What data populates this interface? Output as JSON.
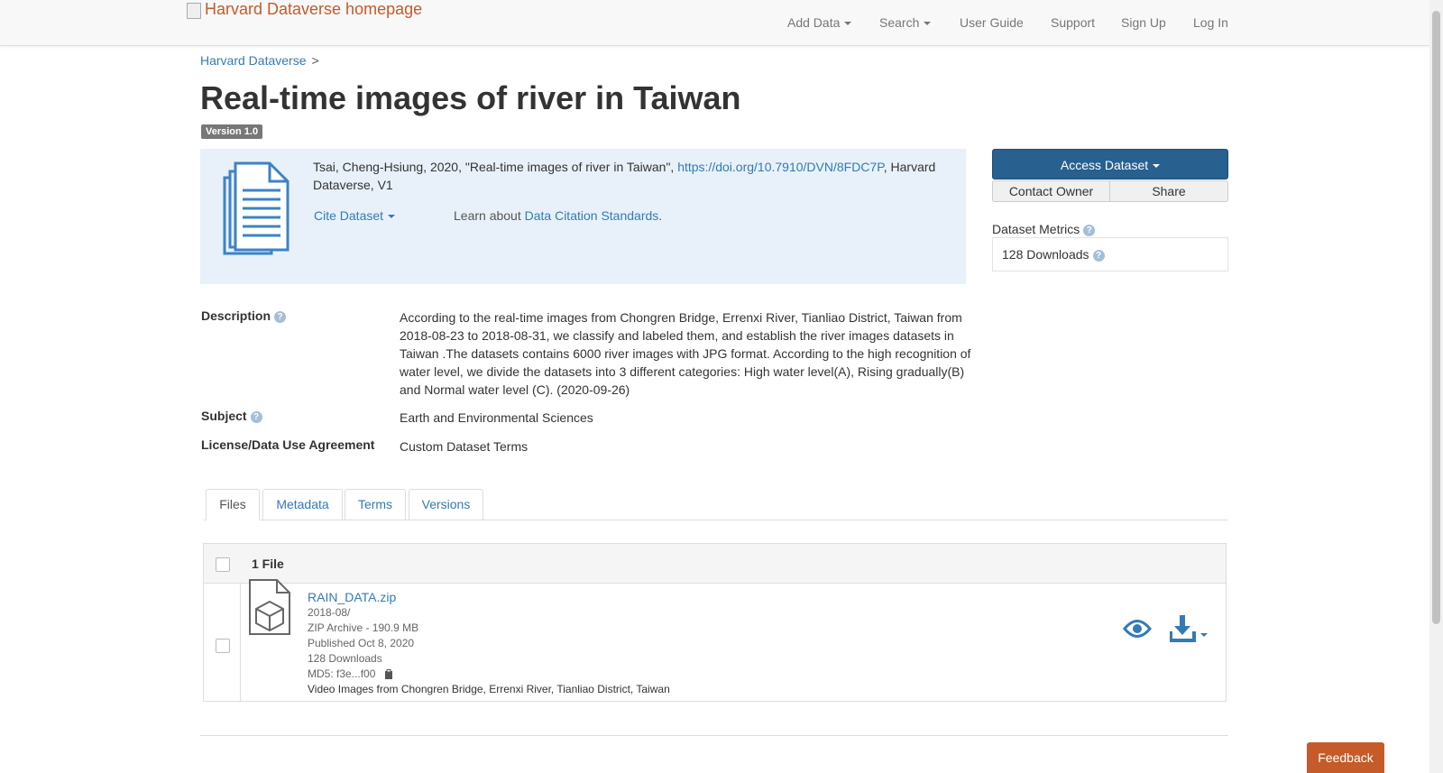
{
  "navbar": {
    "brand_alt": "Harvard Dataverse homepage",
    "items": [
      {
        "label": "Add Data"
      },
      {
        "label": "Search"
      },
      {
        "label": "User Guide"
      },
      {
        "label": "Support"
      },
      {
        "label": "Sign Up"
      },
      {
        "label": "Log In"
      }
    ]
  },
  "breadcrumb": {
    "root": "Harvard Dataverse",
    "sep": ">"
  },
  "dataset": {
    "title": "Real-time images of river in Taiwan",
    "version": "Version 1.0",
    "citation_pre": "Tsai, Cheng-Hsiung, 2020, \"Real-time images of river in Taiwan\", ",
    "doi": "https://doi.org/10.7910/DVN/8FDC7P",
    "citation_post": ", Harvard Dataverse, V1",
    "cite_button": "Cite Dataset",
    "learn_prefix": "Learn about ",
    "learn_link": "Data Citation Standards",
    "learn_suffix": "."
  },
  "actions": {
    "access": "Access Dataset",
    "contact": "Contact Owner",
    "share": "Share"
  },
  "metrics": {
    "label": "Dataset Metrics",
    "downloads": "128 Downloads"
  },
  "metadata": {
    "description_label": "Description",
    "description": "According to the real-time images from Chongren Bridge, Errenxi River, Tianliao District, Taiwan from 2018-08-23 to 2018-08-31, we classify and labeled them, and establish the river images datasets in Taiwan .The datasets contains 6000 river images with JPG format. According to the high recognition of water level, we divide the datasets into 3 different categories: High water level(A), Rising gradually(B) and Normal water level (C). (2020-09-26)",
    "subject_label": "Subject",
    "subject": "Earth and Environmental Sciences",
    "license_label": "License/Data Use Agreement",
    "license": "Custom Dataset Terms"
  },
  "tabs": [
    {
      "label": "Files"
    },
    {
      "label": "Metadata"
    },
    {
      "label": "Terms"
    },
    {
      "label": "Versions"
    }
  ],
  "files": {
    "count": "1 File",
    "items": [
      {
        "name": "RAIN_DATA.zip",
        "folder": "2018-08/",
        "type_size": "ZIP Archive - 190.9 MB",
        "published": "Published Oct 8, 2020",
        "downloads": "128 Downloads",
        "md5": "MD5: f3e...f00",
        "description": "Video Images from Chongren Bridge, Errenxi River, Tianliao District, Taiwan"
      }
    ]
  },
  "feedback": "Feedback",
  "colors": {
    "link": "#337ab7",
    "primary": "#286090",
    "accent": "#c55b28",
    "cite_bg": "#e8f1f9"
  }
}
